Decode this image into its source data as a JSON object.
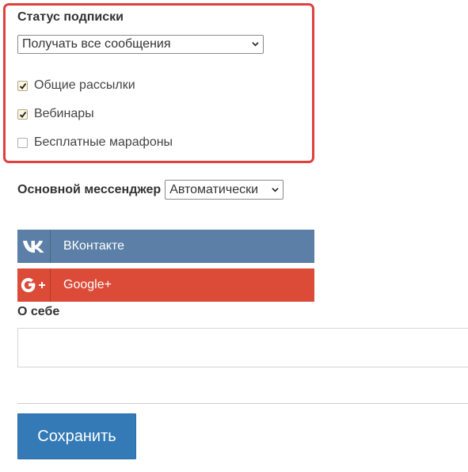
{
  "subscription": {
    "title": "Статус подписки",
    "select_value": "Получать все сообщения",
    "checkboxes": [
      {
        "label": "Общие рассылки",
        "checked": true
      },
      {
        "label": "Вебинары",
        "checked": true
      },
      {
        "label": "Бесплатные марафоны",
        "checked": false
      }
    ],
    "highlight_color": "#e0403e"
  },
  "messenger": {
    "label": "Основной мессенджер",
    "select_value": "Автоматически"
  },
  "social": {
    "vk": {
      "label": "ВКонтакте",
      "icon": "vk-icon",
      "color": "#5b7fa6"
    },
    "google": {
      "label": "Google+",
      "icon": "google-plus-icon",
      "color": "#dc4a38"
    }
  },
  "about": {
    "label": "О себе",
    "value": ""
  },
  "actions": {
    "save_label": "Сохранить",
    "save_color": "#337ab7"
  }
}
